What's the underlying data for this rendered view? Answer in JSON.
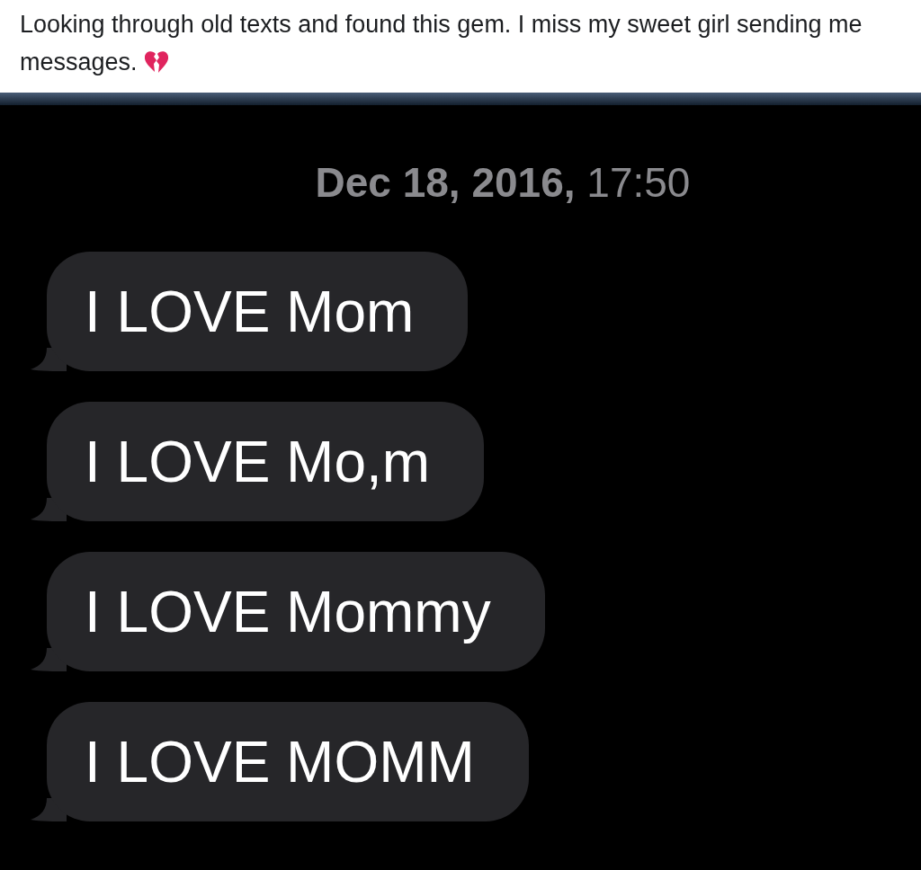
{
  "post": {
    "caption": "Looking through old texts and found this gem. I miss my sweet girl sending me messages."
  },
  "conversation": {
    "timestamp": "**Dec 18, 2016,** 17:50",
    "messages": [
      {
        "text": "I LOVE Mom"
      },
      {
        "text": "I LOVE Mo,m"
      },
      {
        "text": "I LOVE Mommy"
      },
      {
        "text": "I LOVE MOMM"
      }
    ]
  }
}
